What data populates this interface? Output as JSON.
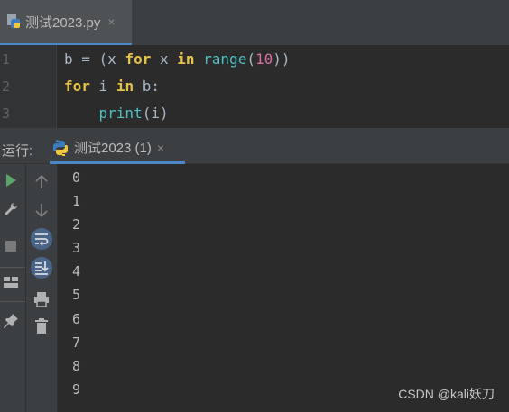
{
  "editor_tab": {
    "title": "测试2023.py",
    "close": "×"
  },
  "editor": {
    "line_numbers": [
      "1",
      "2",
      "3"
    ],
    "lines": [
      [
        {
          "t": "b = (x ",
          "c": "txt"
        },
        {
          "t": "for",
          "c": "kw"
        },
        {
          "t": " x ",
          "c": "txt"
        },
        {
          "t": "in",
          "c": "kw"
        },
        {
          "t": " ",
          "c": "txt"
        },
        {
          "t": "range",
          "c": "fn"
        },
        {
          "t": "(",
          "c": "txt"
        },
        {
          "t": "10",
          "c": "num"
        },
        {
          "t": "))",
          "c": "txt"
        }
      ],
      [
        {
          "t": "for",
          "c": "kw"
        },
        {
          "t": " i ",
          "c": "txt"
        },
        {
          "t": "in",
          "c": "kw"
        },
        {
          "t": " b:",
          "c": "txt"
        }
      ],
      [
        {
          "t": "    ",
          "c": "txt"
        },
        {
          "t": "print",
          "c": "fn"
        },
        {
          "t": "(i)",
          "c": "txt"
        }
      ]
    ]
  },
  "run_panel": {
    "label": "运行:",
    "tab_title": "测试2023 (1)",
    "close": "×",
    "output": [
      "0",
      "1",
      "2",
      "3",
      "4",
      "5",
      "6",
      "7",
      "8",
      "9"
    ]
  },
  "toolbar_left": [
    "rerun-icon",
    "wrench-icon",
    "stop-icon",
    "layout-icon",
    "pin-icon"
  ],
  "toolbar_right": [
    "up-arrow-icon",
    "down-arrow-icon",
    "soft-wrap-icon",
    "scroll-to-end-icon",
    "print-icon",
    "trash-icon"
  ],
  "watermark": "CSDN @kali妖刀",
  "colors": {
    "accent": "#4a88c7",
    "keyword": "#e6c24a",
    "function": "#4ec0c5",
    "number": "#d86ca3",
    "run_green": "#59a869"
  }
}
